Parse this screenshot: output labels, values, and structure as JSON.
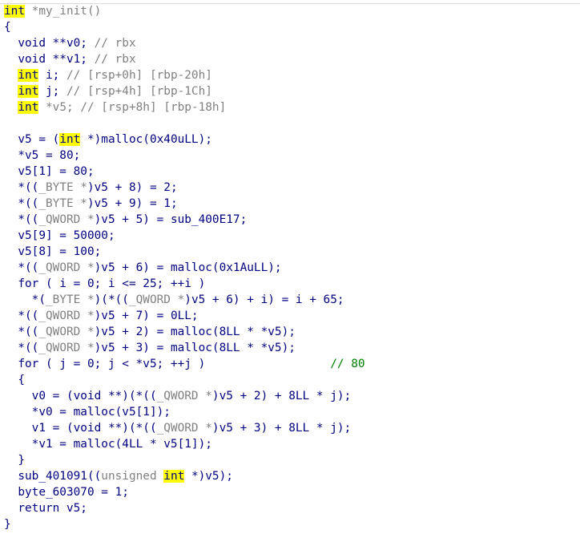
{
  "code_lines": [
    [
      {
        "t": "int",
        "c": "hl"
      },
      {
        "t": " *my_init()",
        "c": "g"
      }
    ],
    [
      {
        "t": "{"
      }
    ],
    [
      {
        "t": "  void **v0; "
      },
      {
        "t": "// rbx",
        "c": "g"
      }
    ],
    [
      {
        "t": "  void **v1; "
      },
      {
        "t": "// rbx",
        "c": "g"
      }
    ],
    [
      {
        "t": "  "
      },
      {
        "t": "int",
        "c": "hl"
      },
      {
        "t": " i; "
      },
      {
        "t": "// [rsp+0h] [rbp-20h]",
        "c": "g"
      }
    ],
    [
      {
        "t": "  "
      },
      {
        "t": "int",
        "c": "hl"
      },
      {
        "t": " j; "
      },
      {
        "t": "// [rsp+4h] [rbp-1Ch]",
        "c": "g"
      }
    ],
    [
      {
        "t": "  "
      },
      {
        "t": "int",
        "c": "hl"
      },
      {
        "t": " *v5; ",
        "c": "g"
      },
      {
        "t": "// [rsp+8h] [rbp-18h]",
        "c": "g"
      }
    ],
    [
      {
        "t": ""
      }
    ],
    [
      {
        "t": "  v5 = ("
      },
      {
        "t": "int",
        "c": "hl"
      },
      {
        "t": " *)malloc(0x40uLL);"
      }
    ],
    [
      {
        "t": "  *v5 = 80;"
      }
    ],
    [
      {
        "t": "  v5[1] = 80;"
      }
    ],
    [
      {
        "t": "  *(("
      },
      {
        "t": "_BYTE *",
        "c": "g"
      },
      {
        "t": ")v5 + 8) = 2;"
      }
    ],
    [
      {
        "t": "  *(("
      },
      {
        "t": "_BYTE *",
        "c": "g"
      },
      {
        "t": ")v5 + 9) = 1;"
      }
    ],
    [
      {
        "t": "  *(("
      },
      {
        "t": "_QWORD *",
        "c": "g"
      },
      {
        "t": ")v5 + 5) = sub_400E17;"
      }
    ],
    [
      {
        "t": "  v5[9] = 50000;"
      }
    ],
    [
      {
        "t": "  v5[8] = 100;"
      }
    ],
    [
      {
        "t": "  *(("
      },
      {
        "t": "_QWORD *",
        "c": "g"
      },
      {
        "t": ")v5 + 6) = malloc(0x1AuLL);"
      }
    ],
    [
      {
        "t": "  for ( i = 0; i <= 25; ++i )"
      }
    ],
    [
      {
        "t": "    *("
      },
      {
        "t": "_BYTE *",
        "c": "g"
      },
      {
        "t": ")(*(("
      },
      {
        "t": "_QWORD *",
        "c": "g"
      },
      {
        "t": ")v5 + 6) + i) = i + 65;"
      }
    ],
    [
      {
        "t": "  *(("
      },
      {
        "t": "_QWORD *",
        "c": "g"
      },
      {
        "t": ")v5 + 7) = 0LL;"
      }
    ],
    [
      {
        "t": "  *(("
      },
      {
        "t": "_QWORD *",
        "c": "g"
      },
      {
        "t": ")v5 + 2) = malloc(8LL * *v5);"
      }
    ],
    [
      {
        "t": "  *(("
      },
      {
        "t": "_QWORD *",
        "c": "g"
      },
      {
        "t": ")v5 + 3) = malloc(8LL * *v5);"
      }
    ],
    [
      {
        "t": "  for ( j = 0; j < *v5; ++j )                  "
      },
      {
        "t": "// 80",
        "c": "cm"
      }
    ],
    [
      {
        "t": "  {"
      }
    ],
    [
      {
        "t": "    v0 = (void **)(*(("
      },
      {
        "t": "_QWORD *",
        "c": "g"
      },
      {
        "t": ")v5 + 2) + 8LL * j);"
      }
    ],
    [
      {
        "t": "    *v0 = malloc(v5[1]);"
      }
    ],
    [
      {
        "t": "    v1 = (void **)(*(("
      },
      {
        "t": "_QWORD *",
        "c": "g"
      },
      {
        "t": ")v5 + 3) + 8LL * j);"
      }
    ],
    [
      {
        "t": "    *v1 = malloc(4LL * v5[1]);"
      }
    ],
    [
      {
        "t": "  }"
      }
    ],
    [
      {
        "t": "  sub_401091(("
      },
      {
        "t": "unsigned ",
        "c": "g"
      },
      {
        "t": "int",
        "c": "hl"
      },
      {
        "t": " *)v5);"
      }
    ],
    [
      {
        "t": "  byte_603070 = 1;"
      }
    ],
    [
      {
        "t": "  return v5;"
      }
    ],
    [
      {
        "t": "}"
      }
    ]
  ]
}
